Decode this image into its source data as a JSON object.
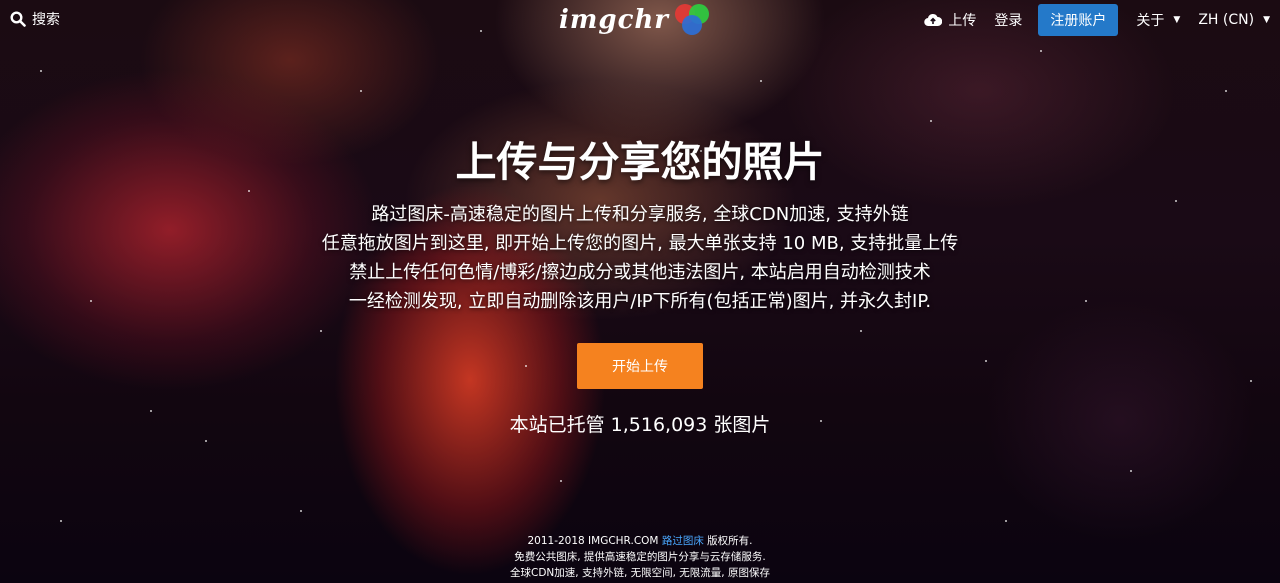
{
  "header": {
    "search_label": "搜索",
    "logo_text": "imgchr",
    "upload_label": "上传",
    "login_label": "登录",
    "register_label": "注册账户",
    "about_label": "关于",
    "language_label": "ZH (CN)"
  },
  "hero": {
    "title": "上传与分享您的照片",
    "lines": [
      "路过图床-高速稳定的图片上传和分享服务, 全球CDN加速, 支持外链",
      "任意拖放图片到这里, 即开始上传您的图片, 最大单张支持 10 MB, 支持批量上传",
      "禁止上传任何色情/博彩/擦边成分或其他违法图片, 本站启用自动检测技术",
      "一经检测发现, 立即自动删除该用户/IP下所有(包括正常)图片, 并永久封IP."
    ],
    "upload_button": "开始上传",
    "stats": "本站已托管 1,516,093 张图片"
  },
  "footer": {
    "copyright_prefix": "2011-2018 IMGCHR.COM",
    "copyright_link": "路过图床",
    "copyright_suffix": "版权所有.",
    "line2": "免费公共图床, 提供高速稳定的图片分享与云存储服务.",
    "line3": "全球CDN加速, 支持外链, 无限空间, 无限流量, 原图保存"
  },
  "colors": {
    "register_button": "#2479c9",
    "upload_button": "#f5821f",
    "footer_link": "#4aa8ff"
  }
}
